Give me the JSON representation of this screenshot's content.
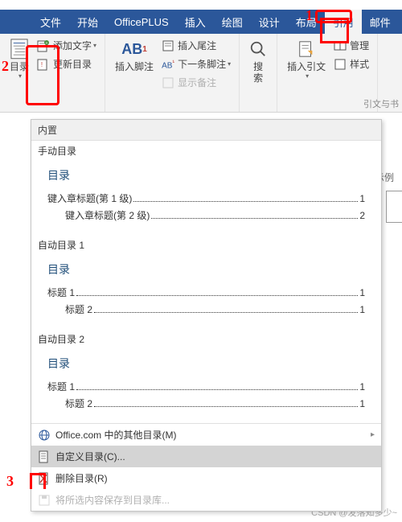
{
  "tabs": [
    "文件",
    "开始",
    "OfficePLUS",
    "插入",
    "绘图",
    "设计",
    "布局",
    "引用",
    "邮件"
  ],
  "active_tab_index": 7,
  "ribbon": {
    "toc": {
      "label": "目录"
    },
    "add_text": "添加文字",
    "update_toc": "更新目录",
    "footnote_big": "插入脚注",
    "insert_endnote": "插入尾注",
    "next_footnote": "下一条脚注",
    "show_notes": "显示备注",
    "search": "搜\n索",
    "insert_citation": "插入引文",
    "manage": "管理",
    "style": "样式",
    "group_label": "引文与书"
  },
  "dropdown": {
    "header": "内置",
    "previews": [
      {
        "title": "手动目录",
        "heading": "目录",
        "lines": [
          {
            "text": "键入章标题(第 1 级)",
            "page": "1",
            "lv": 1
          },
          {
            "text": "键入章标题(第 2 级)",
            "page": "2",
            "lv": 2
          }
        ]
      },
      {
        "title": "自动目录 1",
        "heading": "目录",
        "lines": [
          {
            "text": "标题 1",
            "page": "1",
            "lv": 1
          },
          {
            "text": "标题 2",
            "page": "1",
            "lv": 2
          }
        ]
      },
      {
        "title": "自动目录 2",
        "heading": "目录",
        "lines": [
          {
            "text": "标题 1",
            "page": "1",
            "lv": 1
          },
          {
            "text": "标题 2",
            "page": "1",
            "lv": 2
          }
        ]
      }
    ],
    "more_online": "Office.com 中的其他目录(M)",
    "custom": "自定义目录(C)...",
    "remove": "删除目录(R)",
    "save_selection": "将所选内容保存到目录库..."
  },
  "side_text": "示例",
  "watermark": "CSDN @发落知多少~",
  "annotations": {
    "m1": "1",
    "m2": "2",
    "m3": "3"
  }
}
